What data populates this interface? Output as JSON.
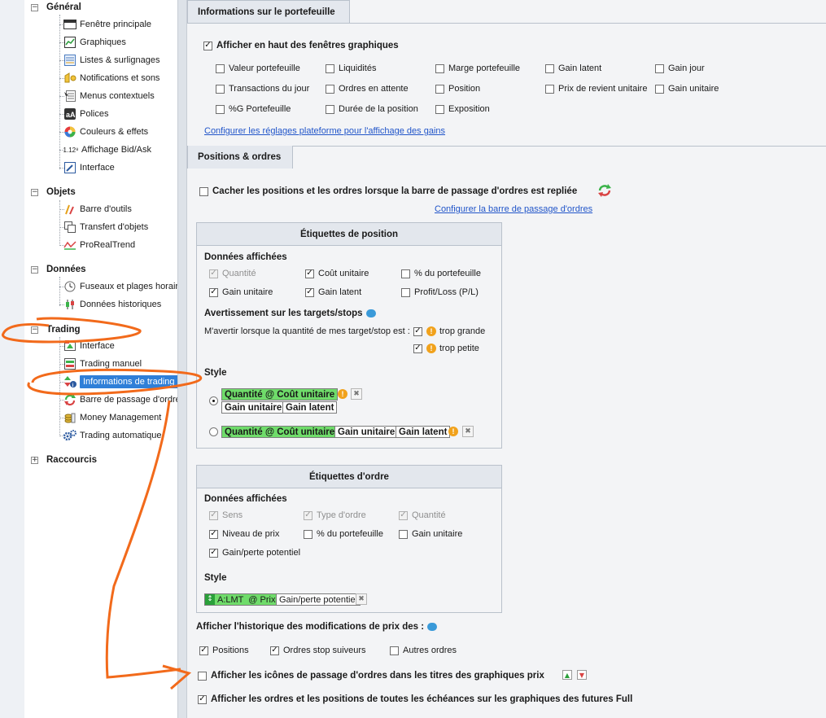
{
  "tree": {
    "sections": [
      {
        "label": "Général",
        "toggle": "−",
        "items": [
          "Fenêtre principale",
          "Graphiques",
          "Listes & surlignages",
          "Notifications et sons",
          "Menus contextuels",
          "Polices",
          "Couleurs & effets",
          "Affichage Bid/Ask",
          "Interface"
        ]
      },
      {
        "label": "Objets",
        "toggle": "−",
        "items": [
          "Barre d'outils",
          "Transfert d'objets",
          "ProRealTrend"
        ]
      },
      {
        "label": "Données",
        "toggle": "−",
        "items": [
          "Fuseaux et plages horaires",
          "Données historiques"
        ]
      },
      {
        "label": "Trading",
        "toggle": "−",
        "items": [
          "Interface",
          "Trading manuel",
          "Informations de trading",
          "Barre de passage d'ordres",
          "Money Management",
          "Trading automatique"
        ]
      },
      {
        "label": "Raccourcis",
        "toggle": "+",
        "items": []
      }
    ],
    "bidask_icon_text": "1.12⁸"
  },
  "portfolio": {
    "tab": "Informations sur le portefeuille",
    "show_top": "Afficher en haut des fenêtres graphiques",
    "options": [
      "Valeur portefeuille",
      "Liquidités",
      "Marge portefeuille",
      "Gain latent",
      "Gain jour",
      "Transactions du jour",
      "Ordres en attente",
      "Position",
      "Prix de revient unitaire",
      "Gain unitaire",
      "%G Portefeuille",
      "Durée de la position",
      "Exposition"
    ],
    "link": "Configurer les réglages plateforme pour l'affichage des gains"
  },
  "positions": {
    "tab": "Positions & ordres",
    "hide": "Cacher les positions et les ordres lorsque la barre de passage d'ordres est repliée",
    "link": "Configurer la barre de passage d'ordres"
  },
  "pos_labels": {
    "title": "Étiquettes de position",
    "data_title": "Données affichées",
    "quantite": "Quantité",
    "cout_unitaire": "Coût unitaire",
    "pct_portefeuille": "% du portefeuille",
    "gain_unitaire": "Gain unitaire",
    "gain_latent": "Gain latent",
    "profit_loss": "Profit/Loss (P/L)",
    "warn_title": "Avertissement sur les targets/stops",
    "warn_text": "M'avertir lorsque la quantité de mes target/stop est :",
    "trop_grande": "trop grande",
    "trop_petite": "trop petite",
    "style_title": "Style",
    "chip_qty": "Quantité @ Coût unitaire",
    "chip_gu": "Gain unitaire",
    "chip_gl": "Gain latent"
  },
  "order_labels": {
    "title": "Étiquettes d'ordre",
    "data_title": "Données affichées",
    "sens": "Sens",
    "type_ordre": "Type d'ordre",
    "quantite": "Quantité",
    "niveau_prix": "Niveau de prix",
    "pct_portefeuille": "% du portefeuille",
    "gain_unitaire": "Gain unitaire",
    "gain_perte": "Gain/perte potentiel",
    "style_title": "Style",
    "chip_a": "A:LMT  @ Prix",
    "chip_b": "Gain/perte potentiel"
  },
  "history": {
    "title": "Afficher l'historique des modifications de prix des :",
    "positions": "Positions",
    "stop_suiveurs": "Ordres stop suiveurs",
    "autres": "Autres ordres"
  },
  "bottom": {
    "icons": "Afficher les icônes de passage d'ordres dans les titres des graphiques prix",
    "futures": "Afficher les ordres et les positions de toutes les échéances sur les graphiques des futures Full"
  },
  "colors": {
    "annotation": "#f26a1b",
    "selected": "#2f7fd8",
    "chip_green": "#6fdc6a",
    "link": "#2155c9"
  }
}
